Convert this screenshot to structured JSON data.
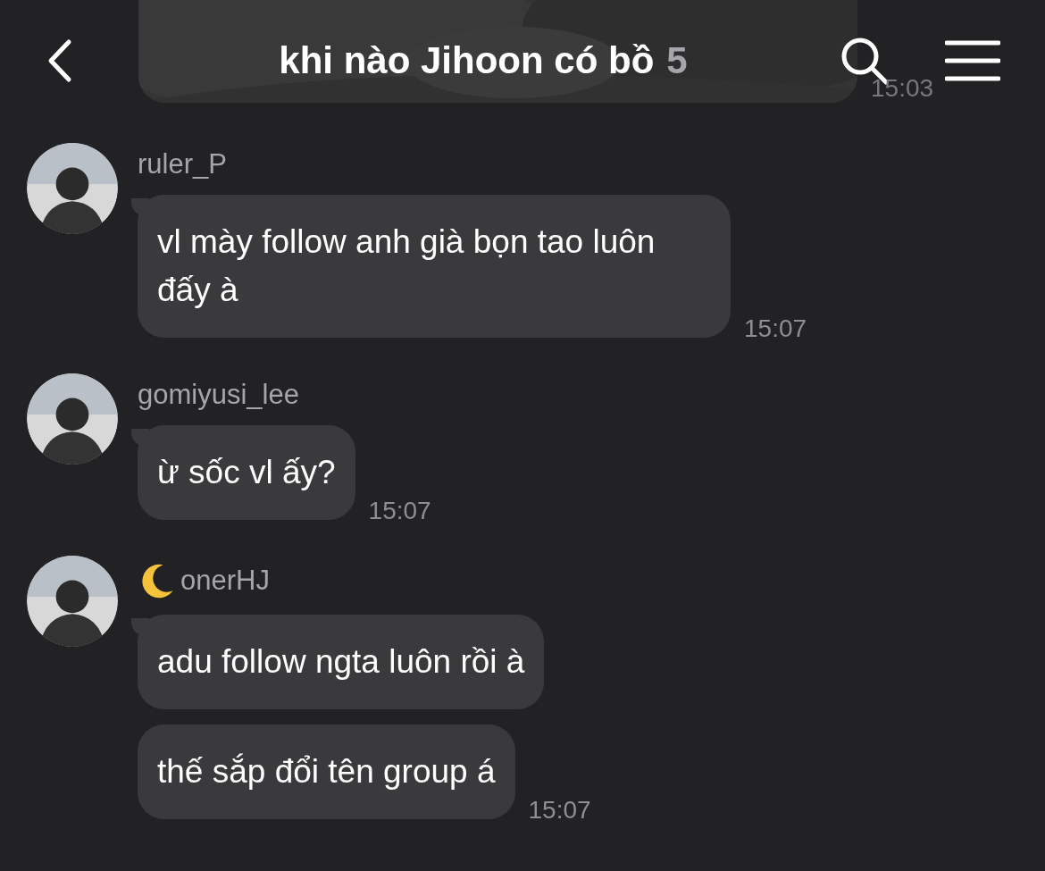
{
  "header": {
    "title": "khi nào Jihoon có bồ",
    "member_count": "5"
  },
  "previous_message": {
    "kind": "picture",
    "time": "15:03"
  },
  "groups": [
    {
      "sender": "ruler_P",
      "moon_icon": false,
      "messages": [
        {
          "text": "vl mày follow anh già bọn tao luôn đấy à",
          "time": "15:07"
        }
      ]
    },
    {
      "sender": "gomiyusi_lee",
      "moon_icon": false,
      "messages": [
        {
          "text": "ừ sốc vl ấy?",
          "time": "15:07"
        }
      ]
    },
    {
      "sender": "onerHJ",
      "moon_icon": true,
      "messages": [
        {
          "text": "adu follow ngta luôn rồi à"
        },
        {
          "text": "thế sắp đổi tên group á",
          "time": "15:07"
        }
      ]
    }
  ]
}
